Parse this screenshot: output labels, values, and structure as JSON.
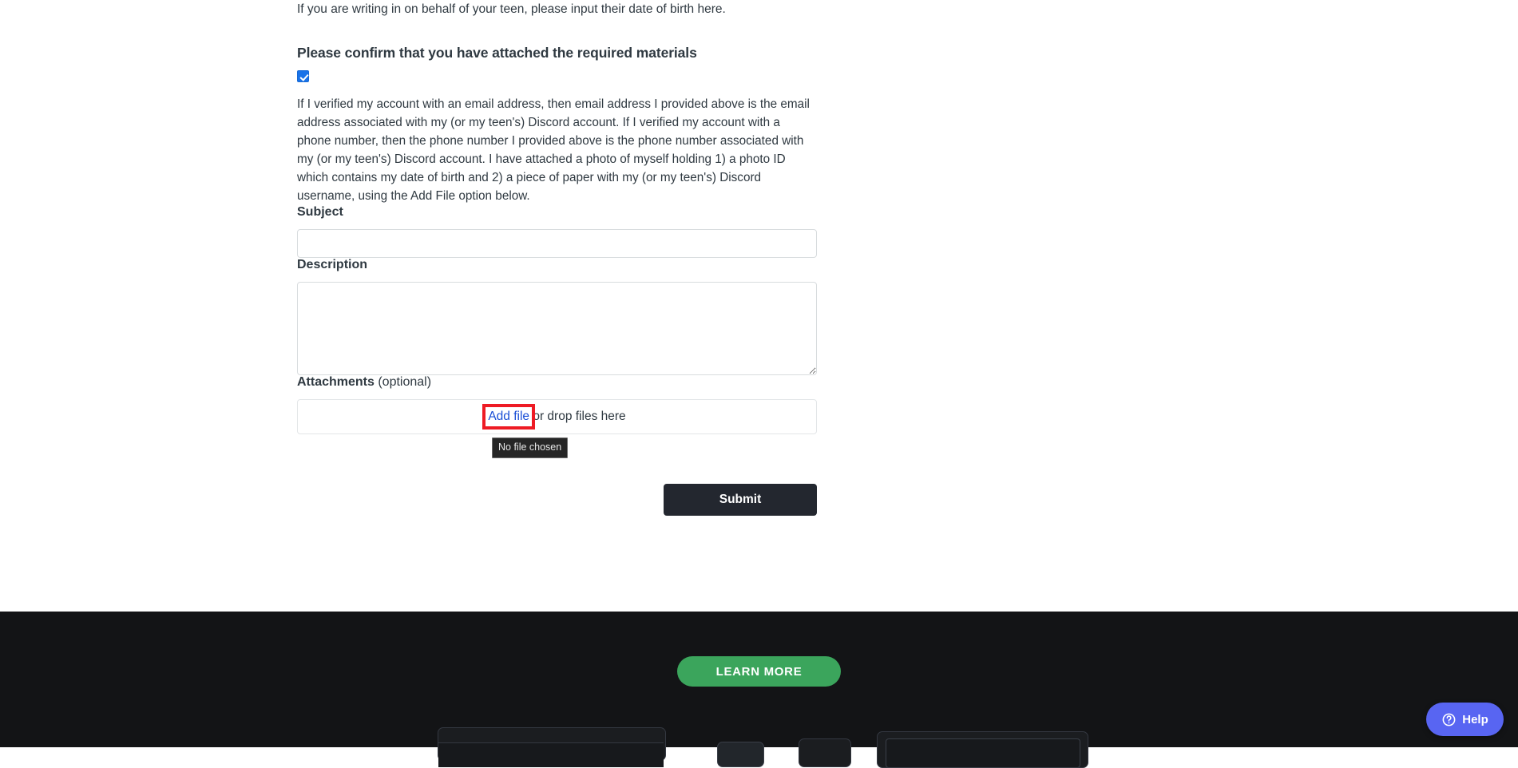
{
  "form": {
    "hint_text": "If you are writing in on behalf of your teen, please input their date of birth here.",
    "section_title": "Please confirm that you have attached the required materials",
    "checkbox_name": "confirm-materials-checkbox",
    "checkbox_checked": true,
    "consent_text": "If I verified my account with an email address, then email address I provided above is the email address associated with my (or my teen's) Discord account. If I verified my account with a phone number, then the phone number I provided above is the phone number associated with my (or my teen's) Discord account. I have attached a photo of myself holding 1) a photo ID which contains my date of birth and 2) a piece of paper with my (or my teen's) Discord username, using the Add File option below.",
    "subject": {
      "label": "Subject",
      "value": "",
      "placeholder": ""
    },
    "description": {
      "label": "Description",
      "value": "",
      "placeholder": ""
    },
    "attachments": {
      "label": "Attachments",
      "optional_suffix": " (optional)",
      "add_file_label": "Add file",
      "drop_hint": " or drop files here",
      "tooltip": "No file chosen"
    },
    "submit_label": "Submit"
  },
  "footer": {
    "learn_more_label": "LEARN MORE"
  },
  "help_widget": {
    "label": "Help",
    "icon": "question-circle-icon"
  },
  "colors": {
    "accent_blue": "#1a4fd6",
    "checkbox_blue": "#1a73e8",
    "highlight_red": "#ee1b24",
    "submit_dark": "#23272f",
    "learn_more_green": "#3ba55c",
    "help_blurple": "#5865f2",
    "footer_background": "#131416",
    "tooltip_background": "#262626"
  }
}
